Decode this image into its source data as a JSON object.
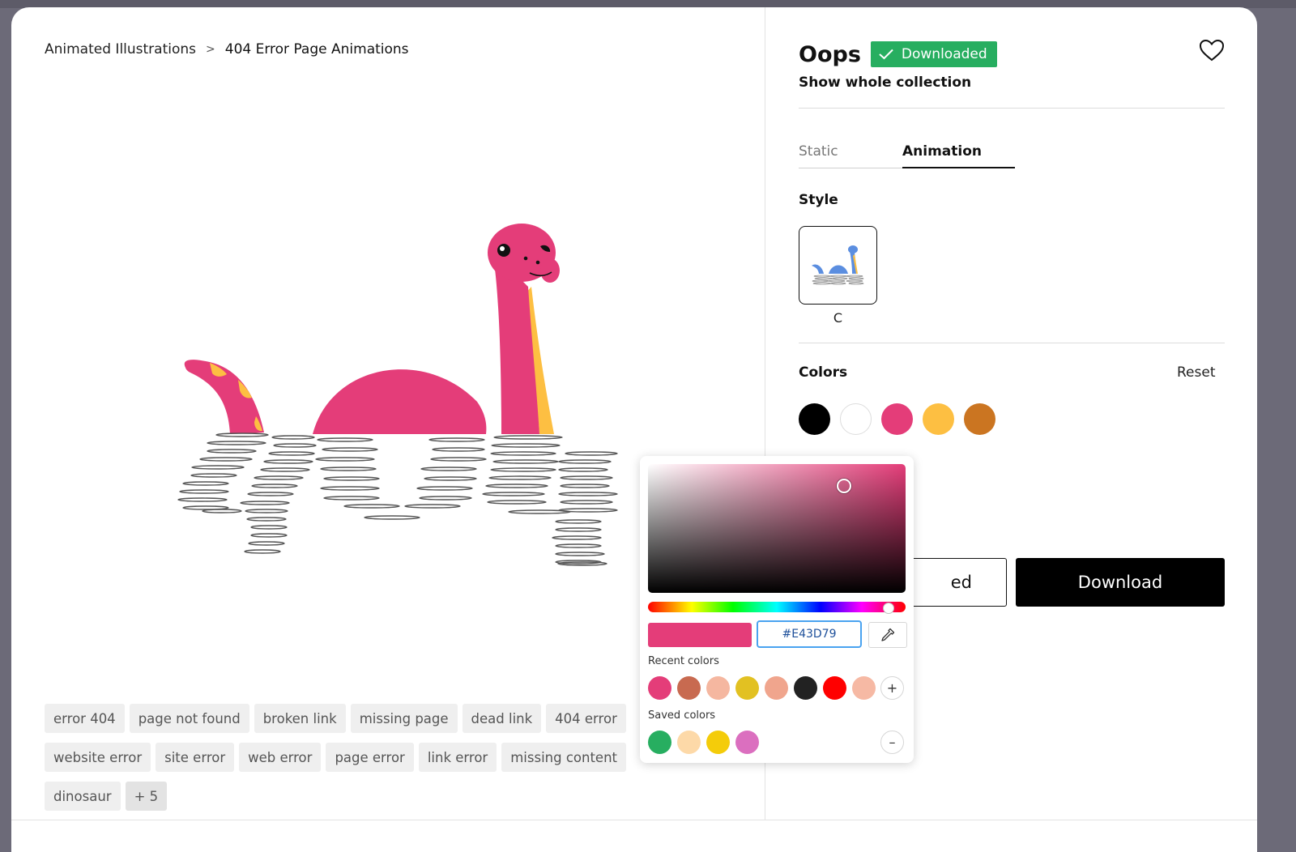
{
  "breadcrumb": {
    "parent": "Animated Illustrations",
    "separator": ">",
    "current": "404 Error Page Animations"
  },
  "tags": {
    "row1": [
      "error 404",
      "page not found",
      "broken link",
      "missing page",
      "dead link",
      "404 error"
    ],
    "row2": [
      "website error",
      "site error",
      "web error",
      "page error",
      "link error",
      "missing content"
    ],
    "row3": [
      "dinosaur"
    ],
    "more": "+ 5"
  },
  "detail": {
    "title": "Oops",
    "badge": "Downloaded",
    "collection_link": "Show whole collection",
    "tabs": [
      "Static",
      "Animation"
    ],
    "active_tab": "Animation",
    "style_label": "Style",
    "style_option": "C",
    "colors_label": "Colors",
    "reset_label": "Reset",
    "swatches": [
      "#000000",
      "#FFFFFF",
      "#E43D79",
      "#FDBF42",
      "#CB7521"
    ],
    "secondary_button_visible": "ed",
    "download_label": "Download"
  },
  "picker": {
    "hex_value": "#E43D79",
    "recent_label": "Recent colors",
    "recent_colors": [
      "#E43D79",
      "#C86A50",
      "#F5B7A0",
      "#E2C122",
      "#F0A58D",
      "#222222",
      "#FF0000",
      "#F6B9A4"
    ],
    "saved_label": "Saved colors",
    "saved_colors": [
      "#27AE60",
      "#FDD9A8",
      "#F4CC0A",
      "#DB6FBF"
    ],
    "add_symbol": "+",
    "remove_symbol": "–"
  },
  "colors": {
    "accent_pink": "#E43D79",
    "accent_yellow": "#FDBF42",
    "badge_green": "#27AE60"
  }
}
